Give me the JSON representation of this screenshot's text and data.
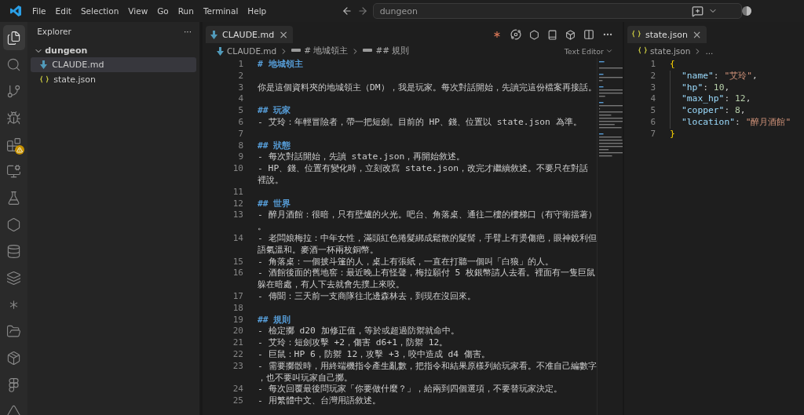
{
  "menu": [
    "File",
    "Edit",
    "Selection",
    "View",
    "Go",
    "Run",
    "Terminal",
    "Help"
  ],
  "nav_search": {
    "value": "dungeon"
  },
  "activity_bar": [
    {
      "selected": true,
      "warning": false
    },
    {
      "selected": false,
      "warning": false
    },
    {
      "selected": false,
      "warning": false
    },
    {
      "selected": false,
      "warning": false
    },
    {
      "selected": false,
      "warning": true
    },
    {
      "selected": false,
      "warning": false
    },
    {
      "selected": false,
      "warning": false
    },
    {
      "selected": false,
      "warning": false
    },
    {
      "selected": false,
      "warning": false
    },
    {
      "selected": false,
      "warning": false
    },
    {
      "selected": false,
      "warning": false
    },
    {
      "selected": false,
      "warning": false
    },
    {
      "selected": false,
      "warning": false
    },
    {
      "selected": false,
      "warning": false
    },
    {
      "selected": false,
      "warning": false
    }
  ],
  "explorer": {
    "title": "Explorer",
    "more": "···",
    "folder": {
      "name": "dungeon",
      "expanded": true
    },
    "files": [
      {
        "name": "CLAUDE.md",
        "kind": "markdown",
        "selected": true
      },
      {
        "name": "state.json",
        "kind": "json",
        "selected": false
      }
    ]
  },
  "left_editor": {
    "tab": {
      "label": "CLAUDE.md",
      "kind": "markdown",
      "selected": true,
      "close": "×"
    },
    "breadcrumb": [
      "CLAUDE.md",
      "# 地城領主",
      "## 規則"
    ],
    "view_label": "Text Editor",
    "lines": [
      {
        "number": "1",
        "kind": "heading",
        "text": "# 地城領主"
      },
      {
        "number": "2",
        "kind": "blank"
      },
      {
        "number": "3",
        "kind": "text",
        "text": "你是這個資料夾的地城領主（DM），我是玩家。每次對話開始，先讀完這份檔案再接話。"
      },
      {
        "number": "4",
        "kind": "blank"
      },
      {
        "number": "5",
        "kind": "heading",
        "text": "## 玩家"
      },
      {
        "number": "6",
        "kind": "text",
        "text": "- 艾玲：年輕冒險者，帶一把短劍。目前的 HP、錢、位置以 state.json 為準。"
      },
      {
        "number": "7",
        "kind": "blank"
      },
      {
        "number": "8",
        "kind": "heading",
        "text": "## 狀態"
      },
      {
        "number": "9",
        "kind": "text",
        "text": "- 每次對話開始，先讀 state.json，再開始敘述。"
      },
      {
        "number": "10",
        "kind": "text",
        "text": "- HP、錢、位置有變化時，立刻改寫 state.json，改完才繼續敘述。不要只在對話裡說。"
      },
      {
        "number": "11",
        "kind": "blank"
      },
      {
        "number": "12",
        "kind": "heading",
        "text": "## 世界"
      },
      {
        "number": "13",
        "kind": "text",
        "text": "- 醉月酒館：很暗，只有壁爐的火光。吧台、角落桌、通往二樓的樓梯口（有守衛擋著）。"
      },
      {
        "number": "14",
        "kind": "text",
        "text": "- 老闆娘梅拉：中年女性，滿頭紅色捲髮綁成鬆散的髮髻，手臂上有燙傷疤，眼神銳利但語氣溫和。麥酒一杯兩枚銅幣。"
      },
      {
        "number": "15",
        "kind": "text",
        "text": "- 角落桌：一個披斗篷的人，桌上有張紙，一直在打聽一個叫「白狼」的人。"
      },
      {
        "number": "16",
        "kind": "text",
        "text": "- 酒館後面的舊地窖：最近晚上有怪聲，梅拉願付 5 枚銀幣請人去看。裡面有一隻巨鼠躲在暗處，有人下去就會先撲上來咬。"
      },
      {
        "number": "17",
        "kind": "text",
        "text": "- 傳聞：三天前一支商隊往北邊森林去，到現在沒回來。"
      },
      {
        "number": "18",
        "kind": "blank"
      },
      {
        "number": "19",
        "kind": "heading",
        "text": "## 規則"
      },
      {
        "number": "20",
        "kind": "text",
        "text": "- 檢定擲 d20 加修正值，等於或超過防禦就命中。"
      },
      {
        "number": "21",
        "kind": "text",
        "text": "- 艾玲：短劍攻擊 +2，傷害 d6+1，防禦 12。"
      },
      {
        "number": "22",
        "kind": "text",
        "text": "- 巨鼠：HP 6，防禦 12，攻擊 +3，咬中造成 d4 傷害。"
      },
      {
        "number": "23",
        "kind": "text",
        "text": "- 需要擲骰時，用終端機指令產生亂數，把指令和結果原樣列給玩家看。不准自己編數字，也不要叫玩家自己擲。"
      },
      {
        "number": "24",
        "kind": "text",
        "text": "- 每次回覆最後問玩家「你要做什麼？」，給兩到四個選項，不要替玩家決定。"
      },
      {
        "number": "25",
        "kind": "text",
        "text": "- 用繁體中文、台灣用語敘述。"
      }
    ]
  },
  "right_editor": {
    "tab": {
      "label": "state.json",
      "kind": "json",
      "selected": true,
      "close": "×"
    },
    "breadcrumb": [
      "state.json",
      "..."
    ],
    "lines": [
      {
        "number": "1",
        "tokens": [
          {
            "kind": "brace",
            "text": "{"
          }
        ]
      },
      {
        "number": "2",
        "tokens": [
          {
            "kind": "key",
            "text": "\"name\""
          },
          {
            "kind": "punct",
            "text": ": "
          },
          {
            "kind": "string",
            "text": "\"艾玲\""
          },
          {
            "kind": "punct",
            "text": ","
          }
        ]
      },
      {
        "number": "3",
        "tokens": [
          {
            "kind": "key",
            "text": "\"hp\""
          },
          {
            "kind": "punct",
            "text": ": "
          },
          {
            "kind": "number",
            "text": "10"
          },
          {
            "kind": "punct",
            "text": ","
          }
        ]
      },
      {
        "number": "4",
        "tokens": [
          {
            "kind": "key",
            "text": "\"max_hp\""
          },
          {
            "kind": "punct",
            "text": ": "
          },
          {
            "kind": "number",
            "text": "12"
          },
          {
            "kind": "punct",
            "text": ","
          }
        ]
      },
      {
        "number": "5",
        "tokens": [
          {
            "kind": "key",
            "text": "\"copper\""
          },
          {
            "kind": "punct",
            "text": ": "
          },
          {
            "kind": "number",
            "text": "8"
          },
          {
            "kind": "punct",
            "text": ","
          }
        ]
      },
      {
        "number": "6",
        "tokens": [
          {
            "kind": "key",
            "text": "\"location\""
          },
          {
            "kind": "punct",
            "text": ": "
          },
          {
            "kind": "string",
            "text": "\"醉月酒館\""
          }
        ]
      },
      {
        "number": "7",
        "tokens": [
          {
            "kind": "brace",
            "text": "}"
          }
        ]
      }
    ]
  }
}
